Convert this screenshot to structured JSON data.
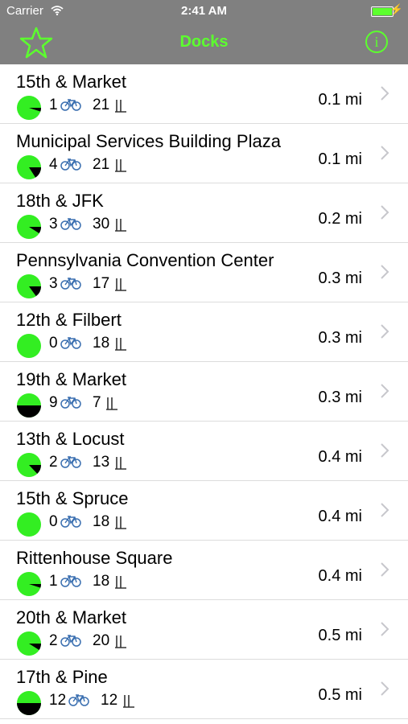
{
  "status_bar": {
    "carrier": "Carrier",
    "time": "2:41 AM",
    "battery_color": "#5cff2e"
  },
  "nav": {
    "title": "Docks",
    "left_icon": "star-icon",
    "right_icon": "info-icon",
    "info_glyph": "i",
    "accent_color": "#5cff2e"
  },
  "stations": [
    {
      "name": "15th & Market",
      "bikes": "1",
      "docks": "21",
      "distance": "0.1 mi",
      "fill": 0.05
    },
    {
      "name": "Municipal Services Building Plaza",
      "bikes": "4",
      "docks": "21",
      "distance": "0.1 mi",
      "fill": 0.16
    },
    {
      "name": "18th & JFK",
      "bikes": "3",
      "docks": "30",
      "distance": "0.2 mi",
      "fill": 0.09
    },
    {
      "name": "Pennsylvania Convention Center",
      "bikes": "3",
      "docks": "17",
      "distance": "0.3 mi",
      "fill": 0.15
    },
    {
      "name": "12th & Filbert",
      "bikes": "0",
      "docks": "18",
      "distance": "0.3 mi",
      "fill": 0
    },
    {
      "name": "19th & Market",
      "bikes": "9",
      "docks": "7",
      "distance": "0.3 mi",
      "fill": 0.5
    },
    {
      "name": "13th & Locust",
      "bikes": "2",
      "docks": "13",
      "distance": "0.4 mi",
      "fill": 0.13
    },
    {
      "name": "15th & Spruce",
      "bikes": "0",
      "docks": "18",
      "distance": "0.4 mi",
      "fill": 0
    },
    {
      "name": "Rittenhouse Square",
      "bikes": "1",
      "docks": "18",
      "distance": "0.4 mi",
      "fill": 0.05
    },
    {
      "name": "20th & Market",
      "bikes": "2",
      "docks": "20",
      "distance": "0.5 mi",
      "fill": 0.09
    },
    {
      "name": "17th & Pine",
      "bikes": "12",
      "docks": "12",
      "distance": "0.5 mi",
      "fill": 0.5
    }
  ]
}
